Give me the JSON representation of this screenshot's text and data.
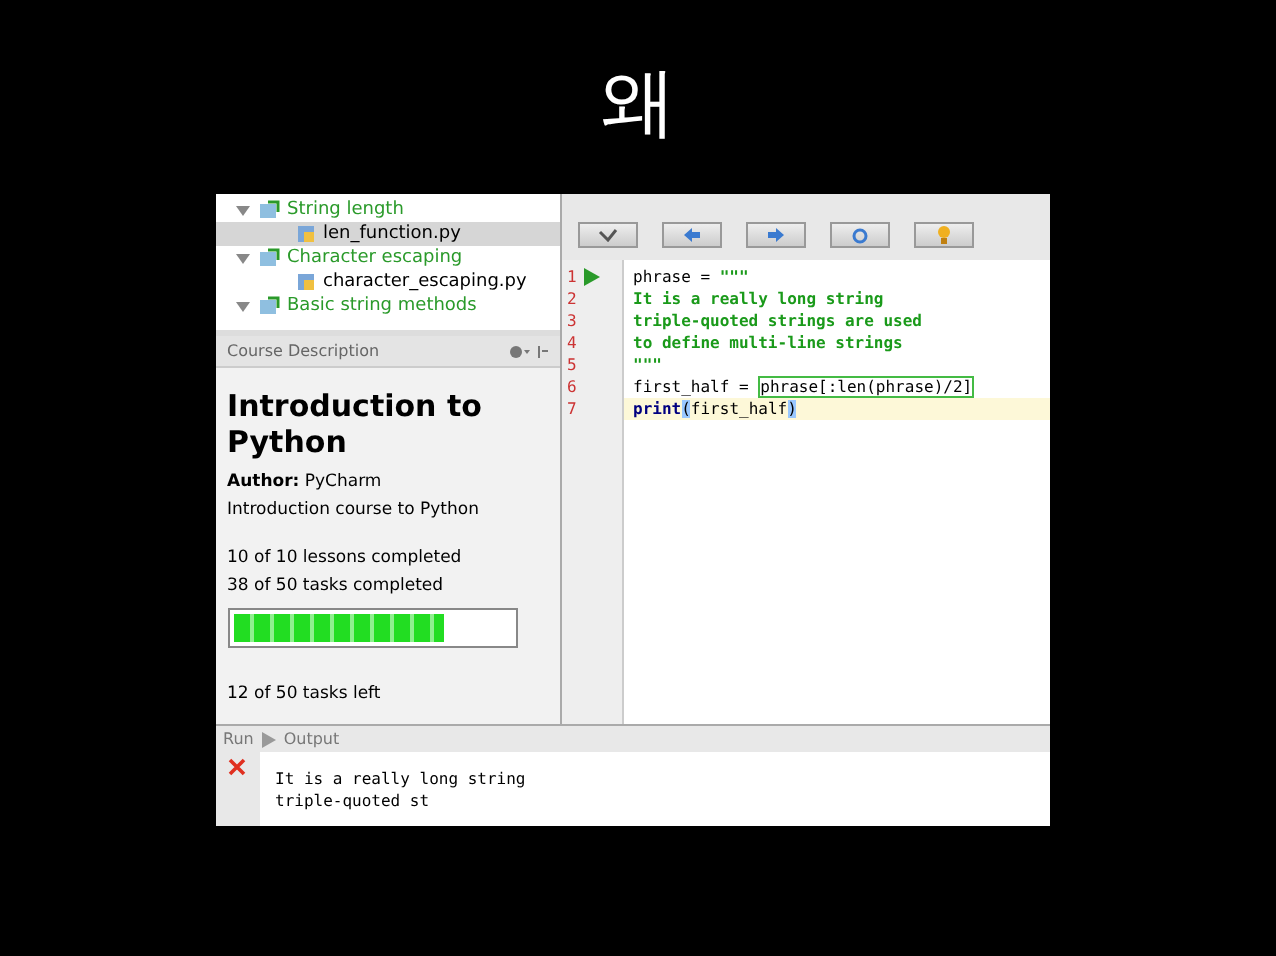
{
  "slide_title": "왜",
  "tree": [
    {
      "label": "String length",
      "expanded": true,
      "children": [
        {
          "label": "len_function.py",
          "selected": true
        }
      ]
    },
    {
      "label": "Character escaping",
      "expanded": true,
      "children": [
        {
          "label": "character_escaping.py",
          "selected": false
        }
      ]
    },
    {
      "label": "Basic string methods",
      "expanded": true
    }
  ],
  "course_panel": {
    "title": "Course Description",
    "heading": "Introduction to Python",
    "author_label": "Author:",
    "author": "PyCharm",
    "description": "Introduction course to Python",
    "lessons": "10 of 10 lessons completed",
    "tasks": "38 of 50 tasks completed",
    "level": 0.76,
    "tasks_left": "12 of 50 tasks left"
  },
  "editor": {
    "lines": [
      {
        "number": "1",
        "current": false,
        "tokens": [
          {
            "kind": "plain",
            "text": "phrase = "
          },
          {
            "kind": "string",
            "text": "\"\"\""
          }
        ]
      },
      {
        "number": "2",
        "current": false,
        "tokens": [
          {
            "kind": "string",
            "text": "It is a really long string"
          }
        ]
      },
      {
        "number": "3",
        "current": false,
        "tokens": [
          {
            "kind": "string",
            "text": "triple-quoted strings are used"
          }
        ]
      },
      {
        "number": "4",
        "current": false,
        "tokens": [
          {
            "kind": "string",
            "text": "to define multi-line strings"
          }
        ]
      },
      {
        "number": "5",
        "current": false,
        "tokens": [
          {
            "kind": "string",
            "text": "\"\"\""
          }
        ]
      },
      {
        "number": "6",
        "current": false,
        "tokens": [
          {
            "kind": "plain",
            "text": "first_half = "
          },
          {
            "kind": "boxed",
            "text": "phrase[:len(phrase)/2]"
          }
        ]
      },
      {
        "number": "7",
        "current": true,
        "tokens": [
          {
            "kind": "keyword",
            "text": "print"
          },
          {
            "kind": "brace",
            "text": "("
          },
          {
            "kind": "plain",
            "text": "first_half"
          },
          {
            "kind": "brace",
            "text": ")"
          }
        ]
      }
    ]
  },
  "run_panel": {
    "tabs": [
      "Run",
      "Output"
    ],
    "output": [
      "It is a really long string",
      "triple-quoted st"
    ]
  }
}
